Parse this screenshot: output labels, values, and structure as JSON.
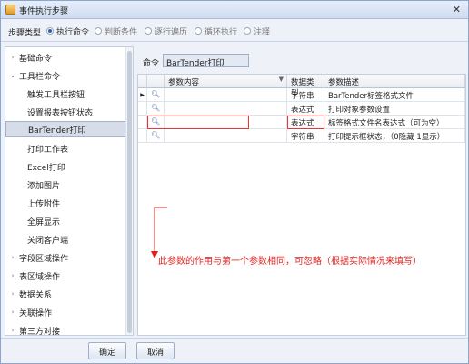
{
  "window": {
    "title": "事件执行步骤",
    "close_glyph": "✕"
  },
  "step_type": {
    "label": "步骤类型",
    "options": [
      {
        "label": "执行命令",
        "checked": true
      },
      {
        "label": "判断条件",
        "checked": false
      },
      {
        "label": "逐行遍历",
        "checked": false
      },
      {
        "label": "循环执行",
        "checked": false
      },
      {
        "label": "注释",
        "checked": false
      }
    ]
  },
  "sidebar": {
    "items": [
      {
        "label": "基础命令",
        "arrow": "›",
        "level": 0
      },
      {
        "label": "工具栏命令",
        "arrow": "⌄",
        "level": 0
      },
      {
        "label": "触发工具栏按钮",
        "arrow": "",
        "level": 1
      },
      {
        "label": "设置报表按钮状态",
        "arrow": "",
        "level": 1
      },
      {
        "label": "BarTender打印",
        "arrow": "",
        "level": 1,
        "selected": true
      },
      {
        "label": "打印工作表",
        "arrow": "",
        "level": 1
      },
      {
        "label": "Excel打印",
        "arrow": "",
        "level": 1
      },
      {
        "label": "添加图片",
        "arrow": "",
        "level": 1
      },
      {
        "label": "上传附件",
        "arrow": "",
        "level": 1
      },
      {
        "label": "全屏显示",
        "arrow": "",
        "level": 1
      },
      {
        "label": "关闭客户端",
        "arrow": "",
        "level": 1
      },
      {
        "label": "字段区域操作",
        "arrow": "›",
        "level": 0
      },
      {
        "label": "表区域操作",
        "arrow": "›",
        "level": 0
      },
      {
        "label": "数据关系",
        "arrow": "›",
        "level": 0
      },
      {
        "label": "关联操作",
        "arrow": "›",
        "level": 0
      },
      {
        "label": "第三方对接",
        "arrow": "›",
        "level": 0
      }
    ]
  },
  "command": {
    "label": "命令",
    "value": "BarTender打印"
  },
  "grid": {
    "headers": [
      "参数内容",
      "数据类型",
      "参数描述"
    ],
    "rows": [
      {
        "indicator": "▶",
        "content": "",
        "type": "字符串",
        "desc": "BarTender标签格式文件"
      },
      {
        "indicator": "",
        "content": "",
        "type": "表达式",
        "desc": "打印对象参数设置"
      },
      {
        "indicator": "",
        "content": "",
        "type": "表达式",
        "desc": "标签格式文件名表达式（可为空）"
      },
      {
        "indicator": "",
        "content": "",
        "type": "字符串",
        "desc": "打印提示框状态，（0隐藏 1显示）"
      }
    ]
  },
  "annotation": {
    "text": "此参数的作用与第一个参数相同，可忽略（根据实际情况来填写）",
    "color": "#e0201f"
  },
  "footer": {
    "ok_label": "确定",
    "cancel_label": "取消"
  },
  "colors": {
    "accent": "#2e5fa8",
    "selection": "#d6dde9",
    "annotation": "#e0201f"
  }
}
